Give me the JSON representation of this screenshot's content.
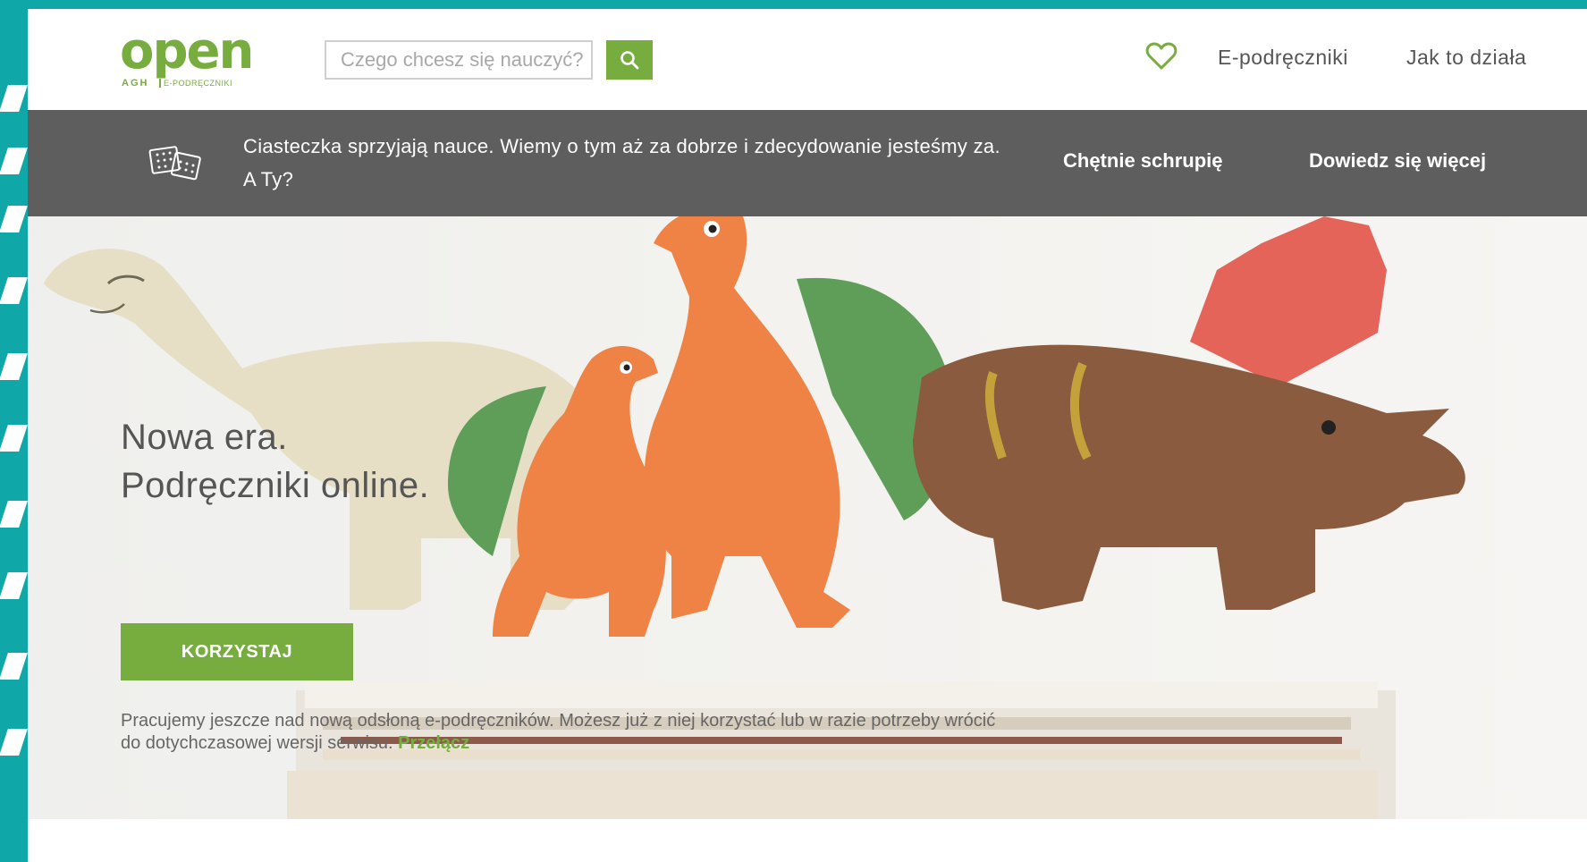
{
  "brand": {
    "logo_text": "open",
    "logo_agh": "AGH",
    "logo_sub": "E-PODRĘCZNIKI",
    "accent_color": "#77ad3e",
    "frame_color": "#0fa7a7"
  },
  "search": {
    "placeholder": "Czego chcesz się nauczyć?",
    "icon": "search-icon"
  },
  "nav": {
    "favorites_icon": "heart-icon",
    "links": [
      "E-podręczniki",
      "Jak to działa"
    ]
  },
  "cookie_bar": {
    "text": "Ciasteczka sprzyjają nauce. Wiemy o tym aż za dobrze i zdecydowanie jesteśmy za. A Ty?",
    "accept_label": "Chętnie schrupię",
    "more_label": "Dowiedz się więcej",
    "icon": "cookie-icon",
    "background": "#5e5e5e"
  },
  "hero": {
    "title_line1": "Nowa era.",
    "title_line2": "Podręczniki online.",
    "cta_label": "KORZYSTAJ",
    "note": "Pracujemy jeszcze nad nową odsłoną e-podręczników. Możesz już z niej korzystać lub w razie potrzeby wrócić do dotychczasowej wersji serwisu.",
    "note_link": "Przełącz"
  }
}
